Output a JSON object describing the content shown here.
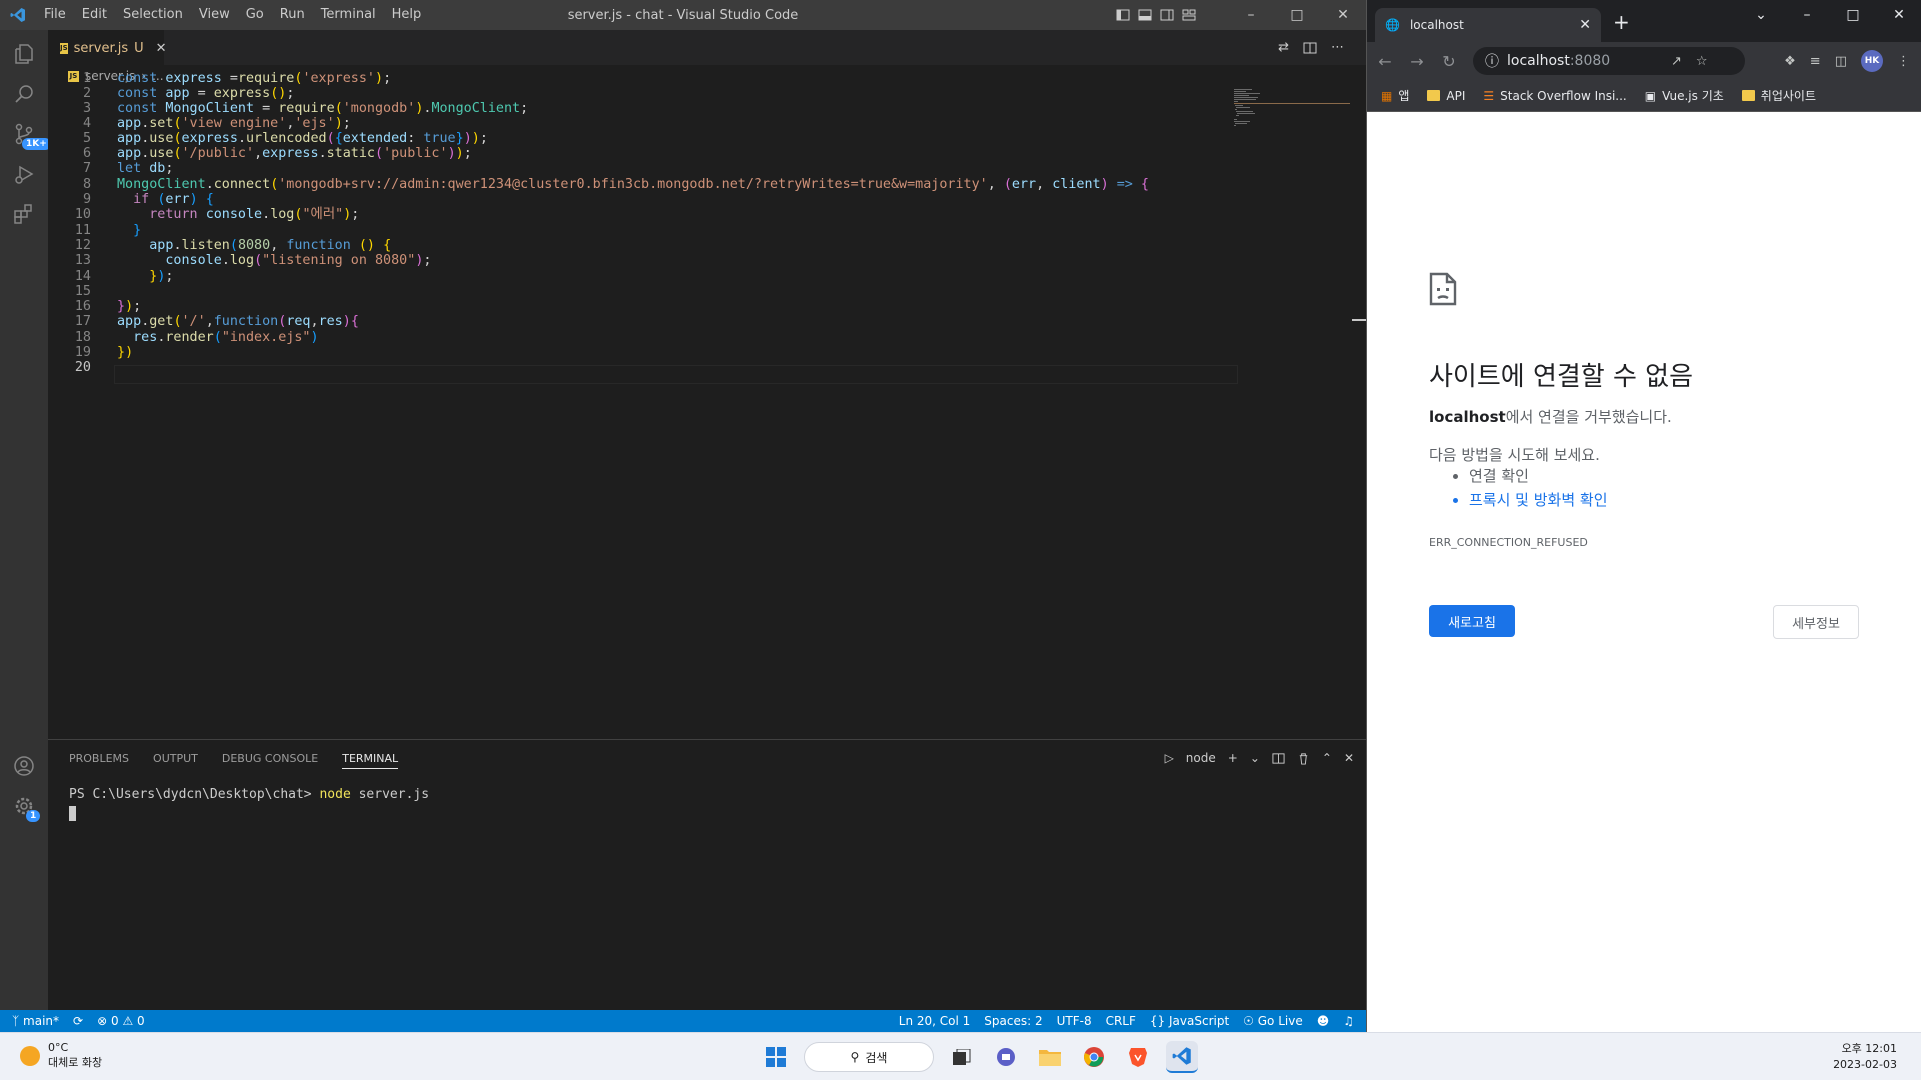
{
  "vscode": {
    "menu": [
      "File",
      "Edit",
      "Selection",
      "View",
      "Go",
      "Run",
      "Terminal",
      "Help"
    ],
    "window_title": "server.js - chat - Visual Studio Code",
    "tab": {
      "filename": "server.js",
      "status": "U"
    },
    "breadcrumb": {
      "file": "server.js",
      "rest": "..."
    },
    "activity_badges": {
      "source_control": "1K+",
      "settings": "1"
    },
    "code_lines": [
      "const express =require('express');",
      "const app = express();",
      "const MongoClient = require('mongodb').MongoClient;",
      "app.set('view engine','ejs');",
      "app.use(express.urlencoded({extended: true}));",
      "app.use('/public',express.static('public'));",
      "let db;",
      "MongoClient.connect('mongodb+srv://admin:qwer1234@cluster0.bfin3cb.mongodb.net/?retryWrites=true&w=majority', (err, client) => {",
      "  if (err) {",
      "    return console.log(\"에러\");",
      "  }",
      "    app.listen(8080, function () {",
      "      console.log(\"listening on 8080\");",
      "    });",
      "",
      "});",
      "app.get('/',function(req,res){",
      "  res.render(\"index.ejs\")",
      "})",
      ""
    ],
    "panel": {
      "tabs": [
        "PROBLEMS",
        "OUTPUT",
        "DEBUG CONSOLE",
        "TERMINAL"
      ],
      "active_tab": "TERMINAL",
      "terminal_name": "node",
      "prompt": "PS C:\\Users\\dydcn\\Desktop\\chat>",
      "command": "node",
      "args": " server.js"
    },
    "status": {
      "branch": "main*",
      "errors": "0",
      "warnings": "0",
      "position": "Ln 20, Col 1",
      "spaces": "Spaces: 2",
      "encoding": "UTF-8",
      "eol": "CRLF",
      "language": "JavaScript",
      "golive": "Go Live"
    }
  },
  "chrome": {
    "tab_title": "localhost",
    "url_host": "localhost",
    "url_port": ":8080",
    "avatar": "HK",
    "bookmarks": [
      "앱",
      "API",
      "Stack Overflow Insi...",
      "Vue.js 기초",
      "취업사이트"
    ],
    "error": {
      "title": "사이트에 연결할 수 없음",
      "host": "localhost",
      "desc_suffix": "에서 연결을 거부했습니다.",
      "try": "다음 방법을 시도해 보세요.",
      "items": [
        "연결 확인",
        "프록시 및 방화벽 확인"
      ],
      "code": "ERR_CONNECTION_REFUSED",
      "reload": "새로고침",
      "details": "세부정보"
    }
  },
  "taskbar": {
    "temp": "0°C",
    "weather": "대체로 화창",
    "search": "검색",
    "time": "오후 12:01",
    "date": "2023-02-03"
  },
  "colors": {
    "vscode_status": "#007acc",
    "chrome_button": "#1a73e8"
  }
}
